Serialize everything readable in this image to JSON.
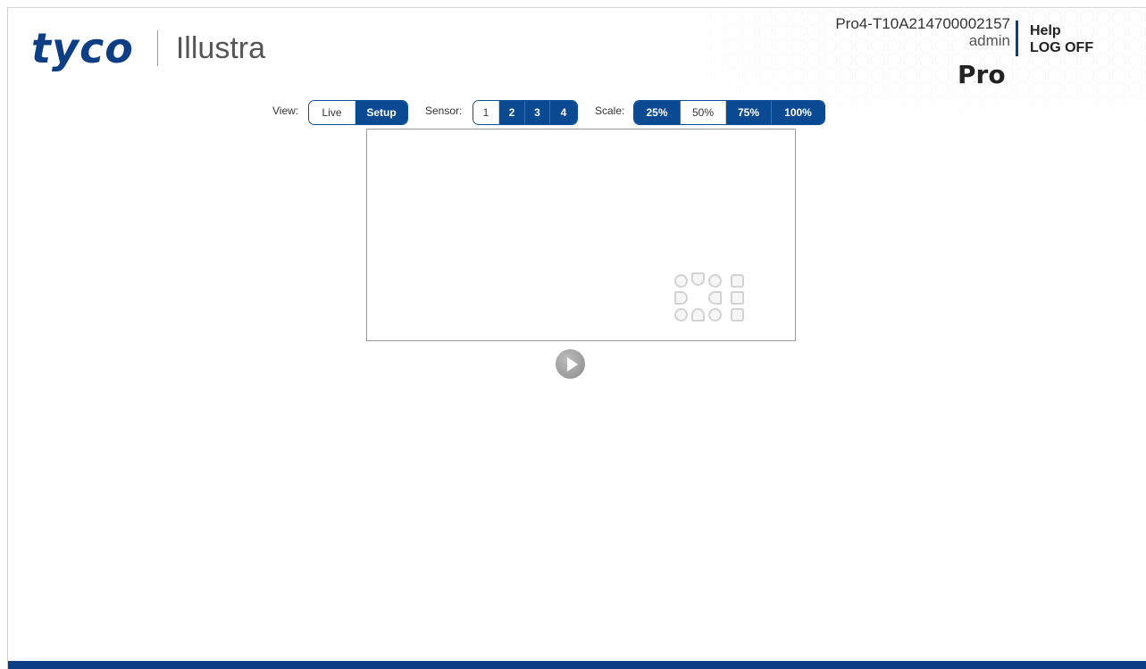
{
  "brand": {
    "company": "tyco",
    "product": "Illustra",
    "model_badge": "Pro",
    "brand_color": "#0d3d82"
  },
  "header": {
    "device_name": "Pro4-T10A214700002157",
    "user": "admin",
    "help_label": "Help",
    "logoff_label": "LOG OFF"
  },
  "toolbar": {
    "view": {
      "label": "View:",
      "options": [
        {
          "label": "Live",
          "selected": false
        },
        {
          "label": "Setup",
          "selected": true
        }
      ]
    },
    "sensor": {
      "label": "Sensor:",
      "options": [
        {
          "label": "1",
          "selected": false
        },
        {
          "label": "2",
          "selected": true
        },
        {
          "label": "3",
          "selected": true
        },
        {
          "label": "4",
          "selected": true
        }
      ]
    },
    "scale": {
      "label": "Scale:",
      "options": [
        {
          "label": "25%",
          "selected": true
        },
        {
          "label": "50%",
          "selected": false
        },
        {
          "label": "75%",
          "selected": true
        },
        {
          "label": "100%",
          "selected": true
        }
      ]
    }
  },
  "video": {
    "ptz_controls": [
      "pan-up-left-icon",
      "pan-up-icon",
      "pan-up-right-icon",
      "zoom-in-icon",
      "pan-left-icon",
      "pan-right-icon",
      "stop-icon",
      "pan-down-left-icon",
      "pan-down-icon",
      "pan-down-right-icon",
      "zoom-out-icon"
    ],
    "play_icon": "play-icon"
  }
}
